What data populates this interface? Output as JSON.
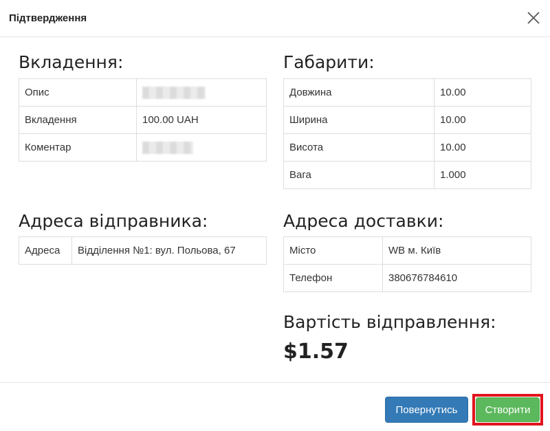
{
  "header": {
    "title": "Підтвердження"
  },
  "contents": {
    "heading": "Вкладення:",
    "rows": [
      {
        "label": "Опис",
        "value": ""
      },
      {
        "label": "Вкладення",
        "value": "100.00 UAH"
      },
      {
        "label": "Коментар",
        "value": ""
      }
    ]
  },
  "dimensions": {
    "heading": "Габарити:",
    "rows": [
      {
        "label": "Довжина",
        "value": "10.00"
      },
      {
        "label": "Ширина",
        "value": "10.00"
      },
      {
        "label": "Висота",
        "value": "10.00"
      },
      {
        "label": "Вага",
        "value": "1.000"
      }
    ]
  },
  "sender_address": {
    "heading": "Адреса відправника:",
    "rows": [
      {
        "label": "Адреса",
        "value": "Відділення №1: вул. Польова, 67"
      }
    ]
  },
  "delivery_address": {
    "heading": "Адреса доставки:",
    "rows": [
      {
        "label": "Місто",
        "value": "WB м. Київ"
      },
      {
        "label": "Телефон",
        "value": "380676784610"
      }
    ]
  },
  "cost": {
    "heading": "Вартість відправлення:",
    "value": "$1.57"
  },
  "footer": {
    "back_label": "Повернутись",
    "create_label": "Створити"
  },
  "colors": {
    "primary": "#337ab7",
    "success": "#5cb85c",
    "highlight": "#e0141e"
  },
  "icons": {
    "close": "close-icon"
  }
}
